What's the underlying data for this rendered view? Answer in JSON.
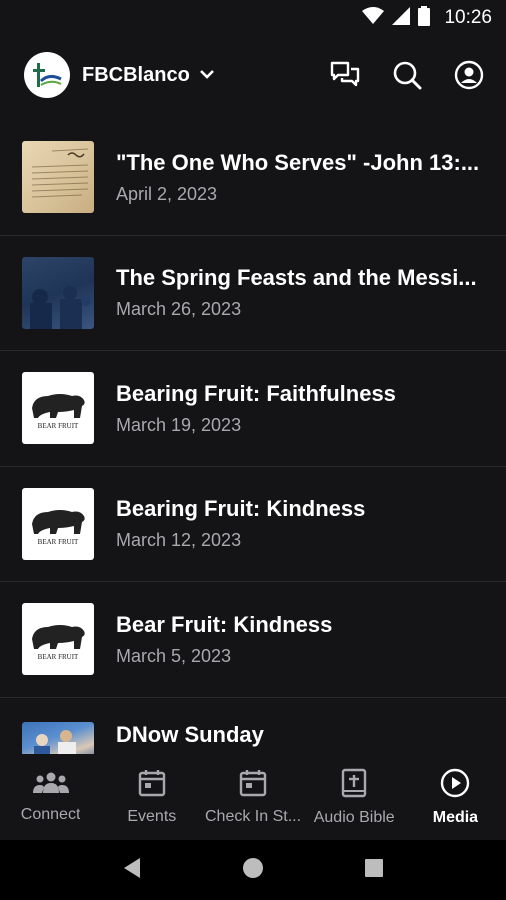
{
  "status_bar": {
    "time": "10:26"
  },
  "header": {
    "church_name": "FBCBlanco"
  },
  "media": [
    {
      "title": "\"The One Who Serves\" -John 13:...",
      "date": "April 2, 2023",
      "thumb": "paper"
    },
    {
      "title": "The Spring Feasts and the Messi...",
      "date": "March 26, 2023",
      "thumb": "blue"
    },
    {
      "title": "Bearing Fruit: Faithfulness",
      "date": "March 19, 2023",
      "thumb": "bear"
    },
    {
      "title": "Bearing Fruit: Kindness",
      "date": "March 12, 2023",
      "thumb": "bear"
    },
    {
      "title": "Bear Fruit: Kindness",
      "date": "March 5, 2023",
      "thumb": "bear"
    },
    {
      "title": "DNow Sunday",
      "date": "",
      "thumb": "photo"
    }
  ],
  "bear_thumb_text": "BEAR FRUIT",
  "nav": [
    {
      "label": "Connect",
      "icon": "people-icon"
    },
    {
      "label": "Events",
      "icon": "calendar-icon"
    },
    {
      "label": "Check In St...",
      "icon": "calendar-check-icon"
    },
    {
      "label": "Audio Bible",
      "icon": "bible-icon"
    },
    {
      "label": "Media",
      "icon": "play-circle-icon",
      "active": true
    }
  ],
  "colors": {
    "background": "#141416",
    "text": "#ffffff",
    "muted": "#a9a9ad",
    "divider": "#2a2a2d"
  }
}
